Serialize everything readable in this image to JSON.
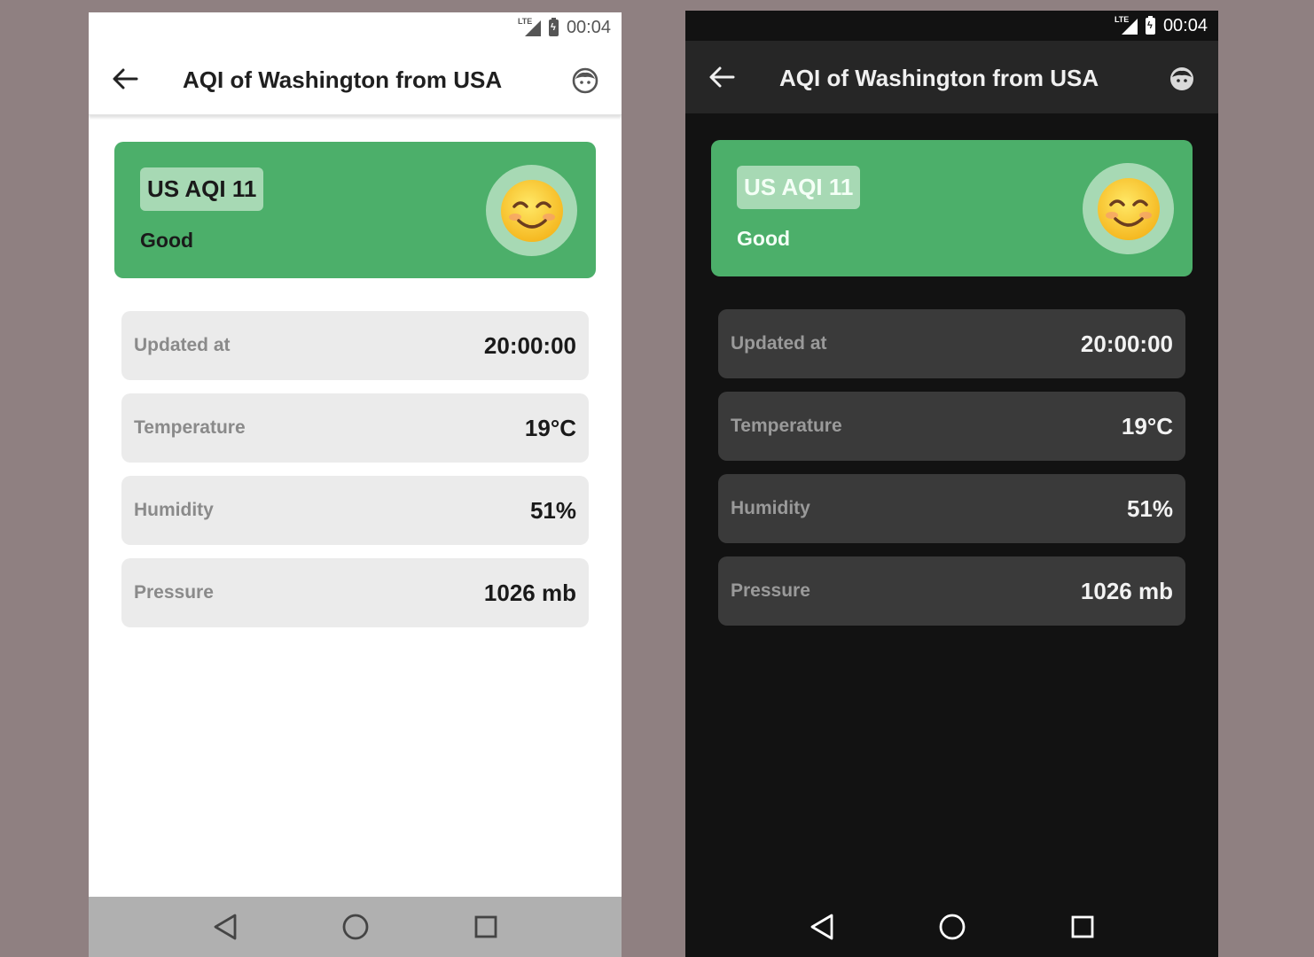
{
  "status": {
    "time": "00:04",
    "network": "LTE"
  },
  "appbar": {
    "title": "AQI of Washington from USA"
  },
  "aqi": {
    "badge": "US AQI 11",
    "status": "Good",
    "emoji": "😊"
  },
  "details": [
    {
      "label": "Updated at",
      "value": "20:00:00"
    },
    {
      "label": "Temperature",
      "value": "19°C"
    },
    {
      "label": "Humidity",
      "value": "51%"
    },
    {
      "label": "Pressure",
      "value": "1026 mb"
    }
  ],
  "colors": {
    "aqi_good": "#4caf6a",
    "badge_bg": "#a7d9b4",
    "light_background": "#ffffff",
    "dark_background": "#121212",
    "page_background": "#8f8081"
  },
  "icons": {
    "back": "arrow-left-icon",
    "profile": "face-icon",
    "nav_back": "triangle-back-icon",
    "nav_home": "circle-home-icon",
    "nav_recents": "square-recents-icon"
  }
}
